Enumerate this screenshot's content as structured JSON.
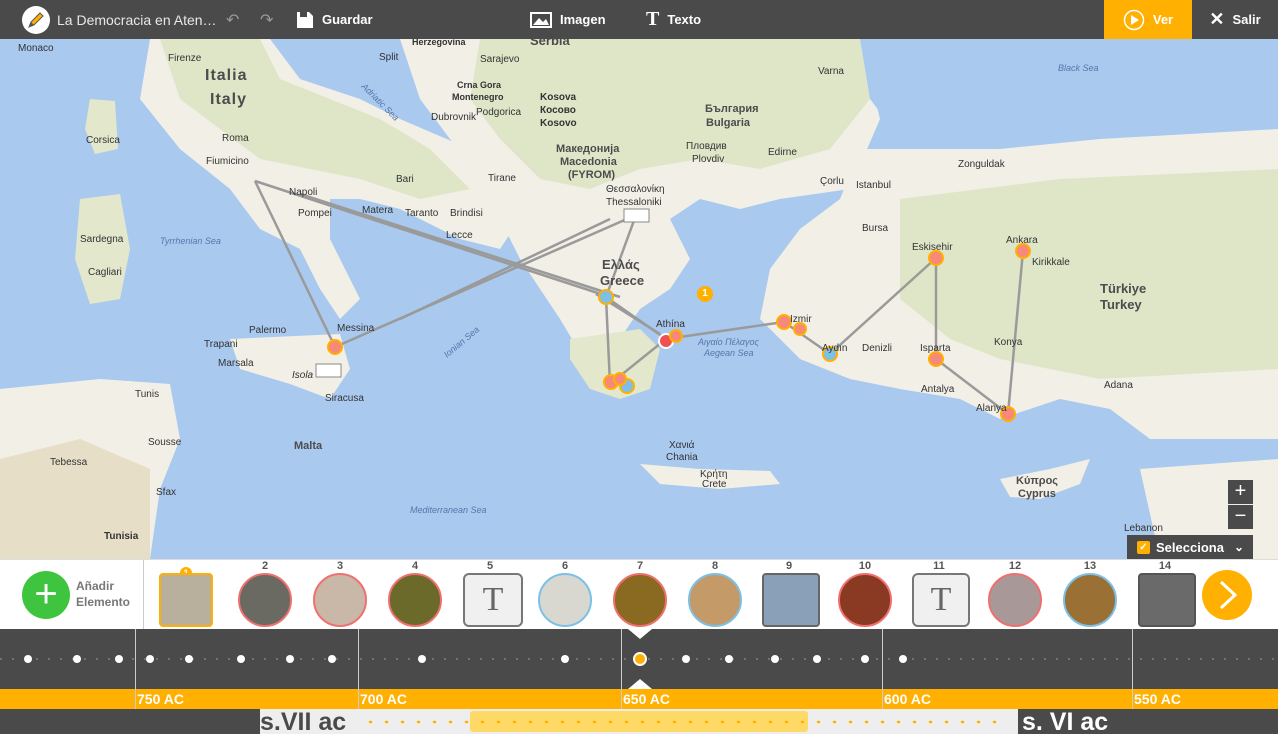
{
  "app": {
    "title": "La Democracia en Aten…",
    "save": "Guardar",
    "image": "Imagen",
    "text": "Texto",
    "view": "Ver",
    "exit": "Salir"
  },
  "map": {
    "countries": [
      {
        "name": "Italia"
      },
      {
        "name": "Italy"
      },
      {
        "name": "Ελλάς"
      },
      {
        "name": "Greece"
      },
      {
        "name": "Türkiye"
      },
      {
        "name": "Turkey"
      },
      {
        "name": "Serbia"
      },
      {
        "name": "България"
      },
      {
        "name": "Bulgaria"
      },
      {
        "name": "Македонија"
      },
      {
        "name": "Macedonia"
      },
      {
        "name": "(FYROM)"
      },
      {
        "name": "Kosova"
      },
      {
        "name": "Косово"
      },
      {
        "name": "Kosovo"
      },
      {
        "name": "Malta"
      },
      {
        "name": "Κύπρος"
      },
      {
        "name": "Cyprus"
      },
      {
        "name": "Crna Gora"
      },
      {
        "name": "Montenegro"
      },
      {
        "name": "Herzegovina"
      }
    ],
    "cities": [
      "Monaco",
      "Firenze",
      "Roma",
      "Fiumicino",
      "Napoli",
      "Pompei",
      "Bari",
      "Matera",
      "Taranto",
      "Brindisi",
      "Lecce",
      "Palermo",
      "Messina",
      "Trapani",
      "Marsala",
      "Isola",
      "Siracusa",
      "Cagliari",
      "Corsica",
      "Sardegna",
      "Split",
      "Sarajevo",
      "Dubrovnik",
      "Podgorica",
      "Tirane",
      "Tunis",
      "Sousse",
      "Sfax",
      "Tebessa",
      "Tunisia",
      "Varna",
      "Plovdiv",
      "Пловдив",
      "Edirne",
      "Istanbul",
      "Çorlu",
      "Bursa",
      "Eskisehir",
      "Ankara",
      "Kirikkale",
      "Zonguldak",
      "Izmir",
      "Aydın",
      "Denizli",
      "Isparta",
      "Antalya",
      "Alanya",
      "Konya",
      "Adana",
      "Θεσσαλονίκη",
      "Thessaloniki",
      "Χανιά",
      "Chania",
      "Κρήτη",
      "Crete",
      "Lebanon",
      "Athína"
    ],
    "seas": [
      "Adriatic Sea",
      "Tyrrhenian Sea",
      "Ionian Sea",
      "Aegean Sea",
      "Αιγαίο Πέλαγος",
      "Mediterranean Sea",
      "Black Sea"
    ],
    "marker_badge": "1",
    "zoom_in": "+",
    "zoom_out": "−",
    "select_label": "Selecciona"
  },
  "strip": {
    "add_line1": "Añadir",
    "add_line2": "Elemento",
    "items": [
      {
        "num": "1",
        "kind": "image",
        "color": "#b8b09c"
      },
      {
        "num": "2",
        "kind": "image",
        "color": "#6a6a62"
      },
      {
        "num": "3",
        "kind": "image",
        "color": "#c9b8a8"
      },
      {
        "num": "4",
        "kind": "image",
        "color": "#6b6a2a"
      },
      {
        "num": "5",
        "kind": "text",
        "color": "#f0f0f0"
      },
      {
        "num": "6",
        "kind": "image",
        "color": "#d8d8d0"
      },
      {
        "num": "7",
        "kind": "image",
        "color": "#8a6a20"
      },
      {
        "num": "8",
        "kind": "image",
        "color": "#c49a68"
      },
      {
        "num": "9",
        "kind": "image",
        "color": "#8aa0b8"
      },
      {
        "num": "10",
        "kind": "image",
        "color": "#8a3a22"
      },
      {
        "num": "11",
        "kind": "text",
        "color": "#f0f0f0"
      },
      {
        "num": "12",
        "kind": "image",
        "color": "#a89898"
      },
      {
        "num": "13",
        "kind": "image",
        "color": "#9a7034"
      },
      {
        "num": "14",
        "kind": "image",
        "color": "#6a6a6a"
      }
    ]
  },
  "timeline": {
    "ticks": [
      "750 AC",
      "700 AC",
      "650 AC",
      "600 AC",
      "550 AC"
    ],
    "centuries": [
      "s.VII ac",
      "s. VI ac"
    ]
  },
  "colors": {
    "accent": "#ffb000",
    "dark": "#4a4a4a",
    "add": "#3ec43e",
    "sea": "#a9c9ef",
    "land": "#f2efe6"
  }
}
